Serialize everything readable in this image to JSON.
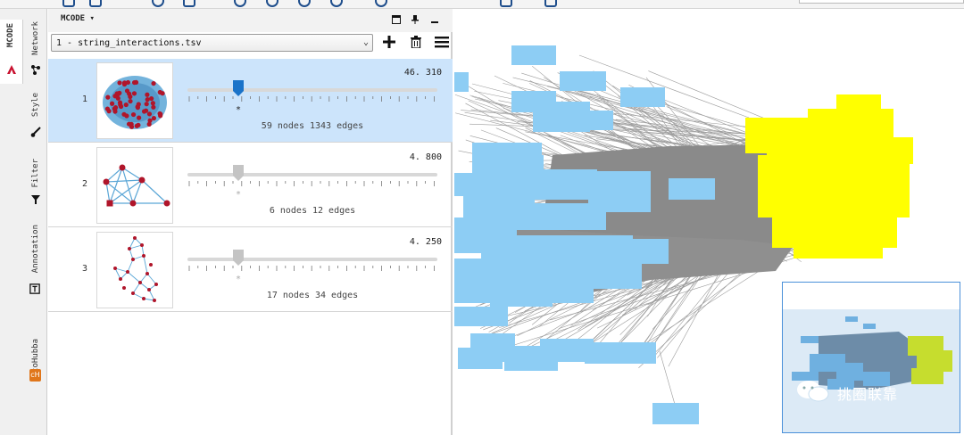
{
  "panel": {
    "title": "MCODE",
    "title_arrow": "▾",
    "network_select": "1 - string_interactions.tsv",
    "select_arrow": "⌄"
  },
  "vtabs": {
    "mcode": "MCODE",
    "network": "Network",
    "style": "Style",
    "filter": "Filter",
    "annotation": "Annotation",
    "cytohubba": "cytoHubba"
  },
  "clusters": [
    {
      "rank": "1",
      "score": "46. 310",
      "info": "59 nodes  1343 edges",
      "star": "*",
      "score_value": 46.31
    },
    {
      "rank": "2",
      "score": "4. 800",
      "info": "6 nodes  12 edges",
      "star": "*",
      "score_value": 4.8
    },
    {
      "rank": "3",
      "score": "4. 250",
      "info": "17 nodes  34 edges",
      "star": "*",
      "score_value": 4.25
    }
  ],
  "watermark": {
    "text": "挑圈联靠"
  },
  "colors": {
    "selected_row": "#cce4fb",
    "node_blue": "#8dcdf4",
    "node_yellow": "#ffff00",
    "edge_gray": "#8a8a8a",
    "slider_active": "#1a73c9",
    "thumb_node": "#b0152a",
    "thumb_edge": "#5aa6d6"
  }
}
